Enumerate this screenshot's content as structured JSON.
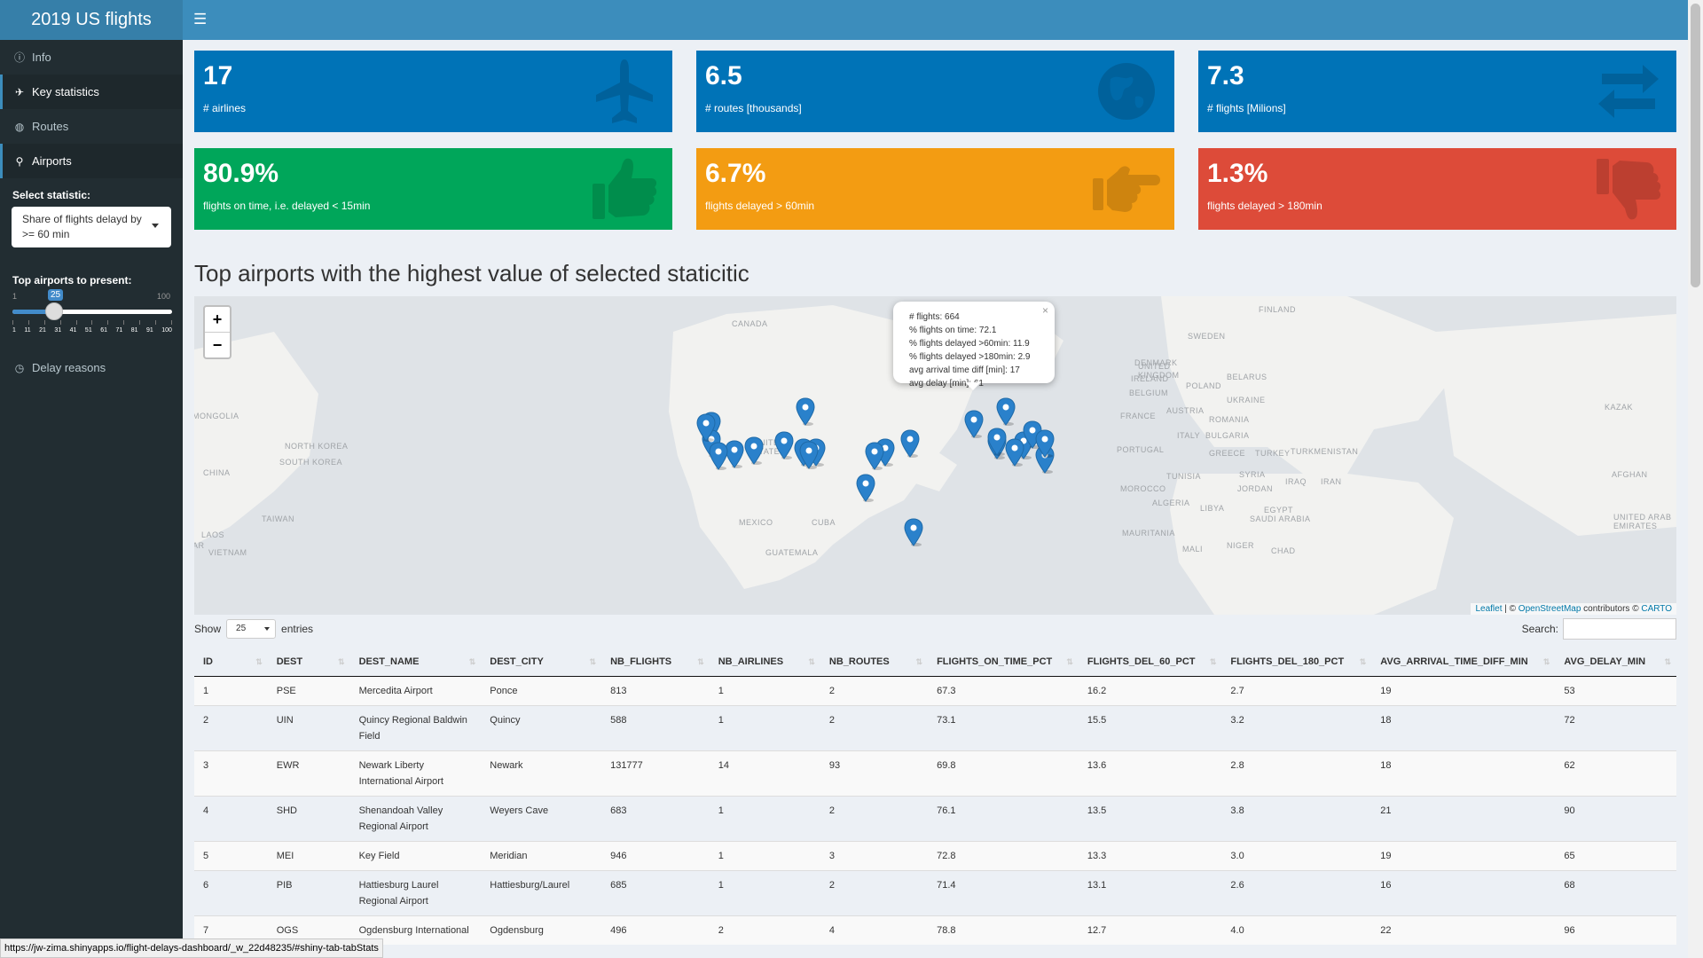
{
  "app": {
    "title": "2019 US flights"
  },
  "sidebar": {
    "items": [
      {
        "label": "Info",
        "icon": "info-circle-icon"
      },
      {
        "label": "Key statistics",
        "icon": "plane-icon"
      },
      {
        "label": "Routes",
        "icon": "globe-icon"
      },
      {
        "label": "Airports",
        "icon": "map-marker-icon"
      }
    ],
    "select_statistic": {
      "label": "Select statistic:",
      "value": "Share of flights delayd by >= 60 min"
    },
    "top_airports": {
      "label": "Top airports to present:",
      "min": "1",
      "max": "100",
      "value": "25",
      "value_fraction": 0.24,
      "grid": [
        "1",
        "11",
        "21",
        "31",
        "41",
        "51",
        "61",
        "71",
        "81",
        "91",
        "100"
      ]
    },
    "delay_reasons": {
      "label": "Delay reasons",
      "icon": "clock-icon"
    }
  },
  "value_boxes": [
    {
      "value": "17",
      "subtitle": "# airlines",
      "icon": "plane-icon",
      "color": "#0073b7"
    },
    {
      "value": "6.5",
      "subtitle": "# routes [thousands]",
      "icon": "globe-icon",
      "color": "#0073b7"
    },
    {
      "value": "7.3",
      "subtitle": "# flights [Milions]",
      "icon": "exchange-arrows-icon",
      "color": "#0073b7"
    },
    {
      "value": "80.9%",
      "subtitle": "flights on time, i.e. delayed < 15min",
      "icon": "thumbs-up-icon",
      "color": "#00a65a"
    },
    {
      "value": "6.7%",
      "subtitle": "flights delayed > 60min",
      "icon": "hand-point-right-icon",
      "color": "#f39c12"
    },
    {
      "value": "1.3%",
      "subtitle": "flights delayed > 180min",
      "icon": "thumbs-down-icon",
      "color": "#dd4b39"
    }
  ],
  "section_title": "Top airports with the highest value of selected staticitic",
  "map": {
    "zoom_in": "+",
    "zoom_out": "−",
    "labels": [
      "FINLAND",
      "SWEDEN",
      "DENMARK",
      "UNITED KINGDOM",
      "IRELAND",
      "BELARUS",
      "POLAND",
      "BELGIUM",
      "UKRAINE",
      "FRANCE",
      "AUSTRIA",
      "ROMANIA",
      "KAZAK",
      "ITALY",
      "BULGARIA",
      "PORTUGAL",
      "GREECE",
      "TURKEY",
      "TURKMENISTAN",
      "TUNISIA",
      "SYRIA",
      "IRAQ",
      "IRAN",
      "AFGHAN",
      "MOROCCO",
      "JORDAN",
      "ALGERIA",
      "LIBYA",
      "EGYPT",
      "SAUDI ARABIA",
      "UNITED ARAB EMIRATES",
      "MAURITANIA",
      "MALI",
      "NIGER",
      "CHAD",
      "MONGOLIA",
      "NORTH KOREA",
      "SOUTH KOREA",
      "CHINA",
      "TAIWAN",
      "LAOS",
      "VIETNAM",
      "AR",
      "CANADA",
      "UNITED STATES",
      "MEXICO",
      "CUBA",
      "GUATEMALA"
    ],
    "popup": {
      "close": "×",
      "lines": [
        "# flights: 664",
        "% flights on time: 72.1",
        "% flights delayed >60min: 11.9",
        "% flights delayed >180min: 2.9",
        "avg arrival time diff [min]: 17",
        "avg delay [min]: 61"
      ]
    },
    "attribution": {
      "leaflet": "Leaflet",
      "sep1": " | © ",
      "osm": "OpenStreetMap",
      "mid": " contributors © ",
      "carto": "CARTO"
    }
  },
  "table": {
    "show_label": "Show",
    "entries_value": "25",
    "entries_label": "entries",
    "search_label": "Search:",
    "columns": [
      "ID",
      "DEST",
      "DEST_NAME",
      "DEST_CITY",
      "NB_FLIGHTS",
      "NB_AIRLINES",
      "NB_ROUTES",
      "FLIGHTS_ON_TIME_PCT",
      "FLIGHTS_DEL_60_PCT",
      "FLIGHTS_DEL_180_PCT",
      "AVG_ARRIVAL_TIME_DIFF_MIN",
      "AVG_DELAY_MIN"
    ],
    "rows": [
      [
        "1",
        "PSE",
        "Mercedita Airport",
        "Ponce",
        "813",
        "1",
        "2",
        "67.3",
        "16.2",
        "2.7",
        "19",
        "53"
      ],
      [
        "2",
        "UIN",
        "Quincy Regional Baldwin Field",
        "Quincy",
        "588",
        "1",
        "2",
        "73.1",
        "15.5",
        "3.2",
        "18",
        "72"
      ],
      [
        "3",
        "EWR",
        "Newark Liberty International Airport",
        "Newark",
        "131777",
        "14",
        "93",
        "69.8",
        "13.6",
        "2.8",
        "18",
        "62"
      ],
      [
        "4",
        "SHD",
        "Shenandoah Valley Regional Airport",
        "Weyers Cave",
        "683",
        "1",
        "2",
        "76.1",
        "13.5",
        "3.8",
        "21",
        "90"
      ],
      [
        "5",
        "MEI",
        "Key Field",
        "Meridian",
        "946",
        "1",
        "3",
        "72.8",
        "13.3",
        "3.0",
        "19",
        "65"
      ],
      [
        "6",
        "PIB",
        "Hattiesburg Laurel Regional Airport",
        "Hattiesburg/Laurel",
        "685",
        "1",
        "2",
        "71.4",
        "13.1",
        "2.6",
        "16",
        "68"
      ],
      [
        "7",
        "OGS",
        "Ogdensburg International",
        "Ogdensburg",
        "496",
        "2",
        "4",
        "78.8",
        "12.7",
        "4.0",
        "22",
        "96"
      ]
    ]
  },
  "status_url": "https://jw-zima.shinyapps.io/flight-delays-dashboard/_w_22d48235/#shiny-tab-tabStats"
}
